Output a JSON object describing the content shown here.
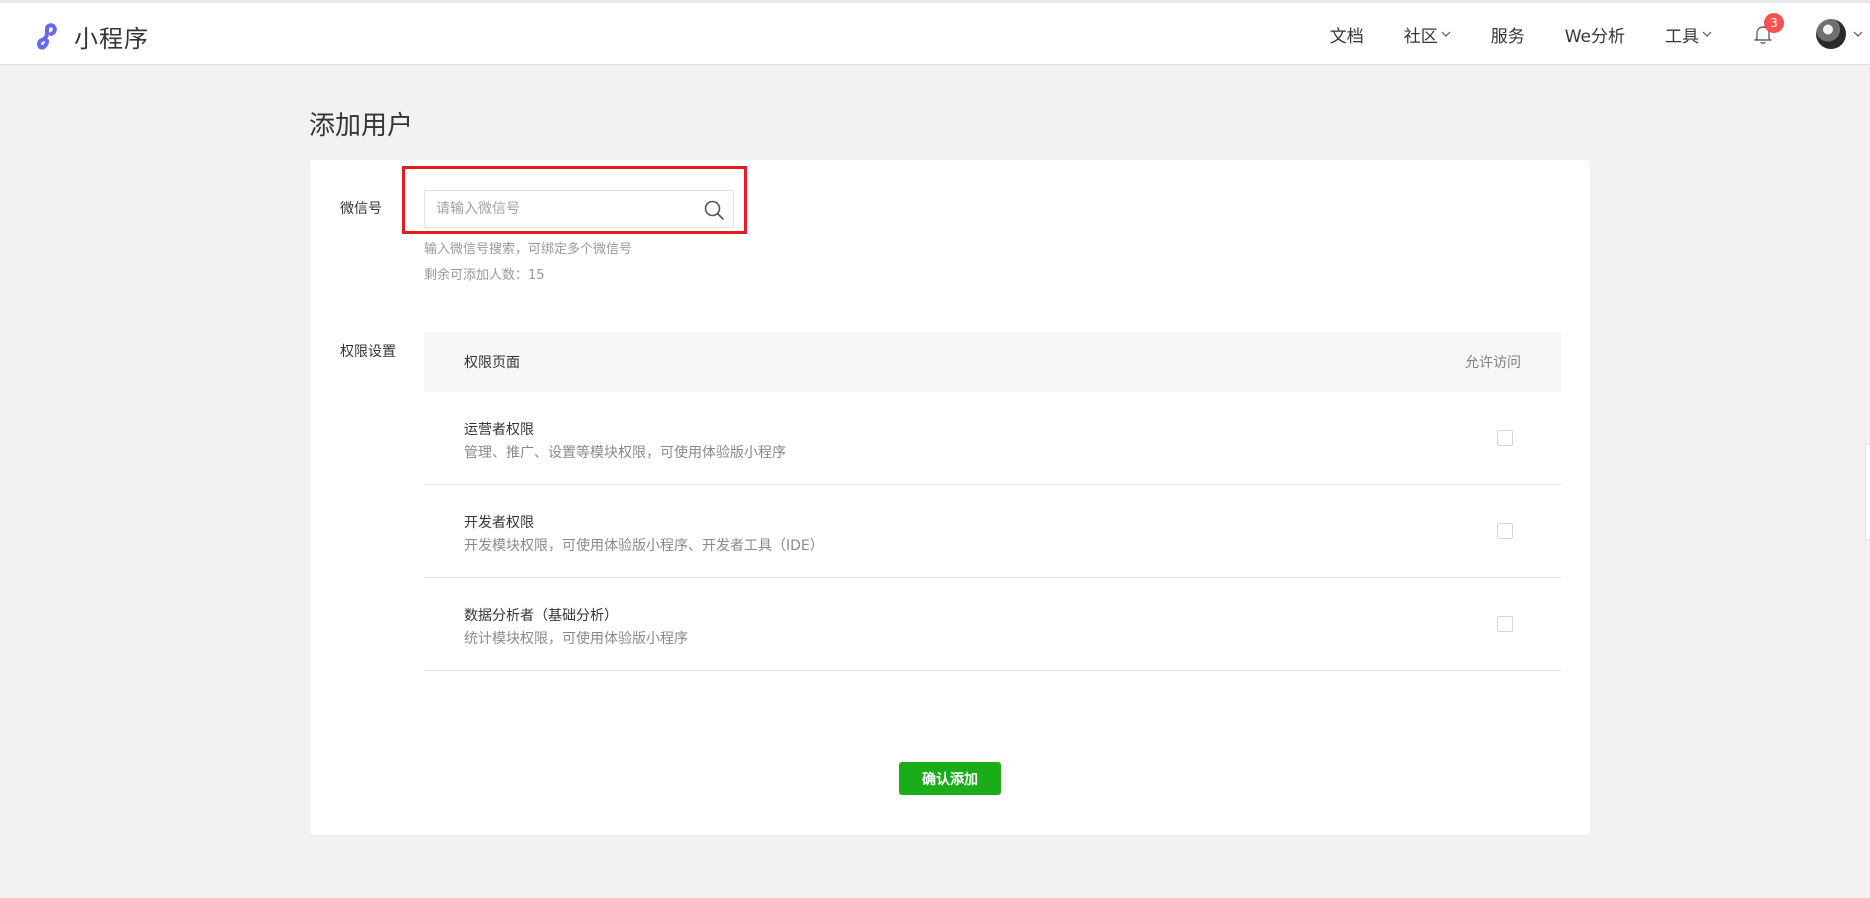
{
  "app": {
    "logo_icon": "miniprogram-logo-icon",
    "title": "小程序",
    "brand_color": "#6467f0"
  },
  "nav": {
    "items": [
      {
        "label": "文档",
        "has_dropdown": false
      },
      {
        "label": "社区",
        "has_dropdown": true
      },
      {
        "label": "服务",
        "has_dropdown": false
      },
      {
        "label": "We分析",
        "has_dropdown": false
      },
      {
        "label": "工具",
        "has_dropdown": true
      }
    ],
    "notifications": {
      "icon": "bell-icon",
      "count": "3",
      "badge_color": "#fa5151"
    },
    "avatar": {
      "icon": "avatar"
    }
  },
  "page": {
    "title": "添加用户"
  },
  "wechat_field": {
    "label": "微信号",
    "placeholder": "请输入微信号",
    "value": "",
    "search_icon": "search-icon",
    "hint1": "输入微信号搜索，可绑定多个微信号",
    "hint2": "剩余可添加人数：15"
  },
  "permissions": {
    "label": "权限设置",
    "header_left": "权限页面",
    "header_right": "允许访问",
    "rows": [
      {
        "name": "运营者权限",
        "desc": "管理、推广、设置等模块权限，可使用体验版小程序",
        "checked": false
      },
      {
        "name": "开发者权限",
        "desc": "开发模块权限，可使用体验版小程序、开发者工具（IDE）",
        "checked": false
      },
      {
        "name": "数据分析者（基础分析）",
        "desc": "统计模块权限，可使用体验版小程序",
        "checked": false
      }
    ]
  },
  "actions": {
    "confirm_label": "确认添加",
    "confirm_color": "#1aad19"
  },
  "highlight": {
    "color": "#e51c23"
  }
}
